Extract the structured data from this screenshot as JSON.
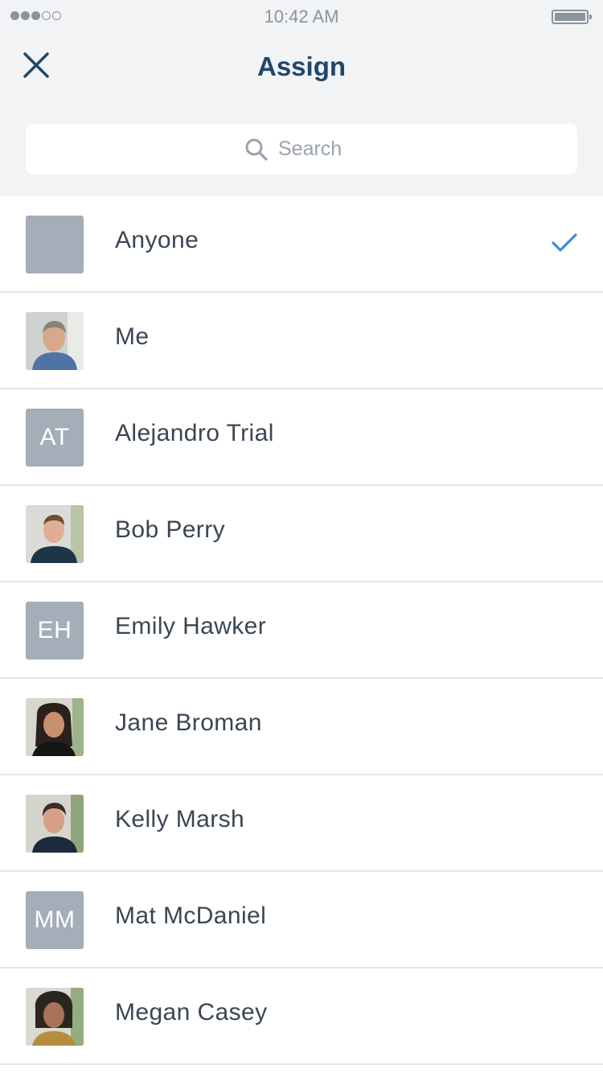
{
  "status_bar": {
    "time": "10:42 AM",
    "signal_bars_filled": 3,
    "signal_bars_total": 5,
    "battery_level": 1.0
  },
  "header": {
    "title": "Assign",
    "close_icon": "close-icon"
  },
  "search": {
    "placeholder": "Search",
    "value": "",
    "icon": "search-icon"
  },
  "colors": {
    "accent": "#20476b",
    "check": "#3a8ed8",
    "avatar_placeholder": "#a3aeb9",
    "background_top": "#f2f3f5"
  },
  "assignees": [
    {
      "name": "Anyone",
      "initials": "",
      "avatar_type": "blank",
      "selected": true
    },
    {
      "name": "Me",
      "initials": "",
      "avatar_type": "photo",
      "selected": false
    },
    {
      "name": "Alejandro Trial",
      "initials": "AT",
      "avatar_type": "initials",
      "selected": false
    },
    {
      "name": "Bob Perry",
      "initials": "",
      "avatar_type": "photo",
      "selected": false
    },
    {
      "name": "Emily Hawker",
      "initials": "EH",
      "avatar_type": "initials",
      "selected": false
    },
    {
      "name": "Jane Broman",
      "initials": "",
      "avatar_type": "photo",
      "selected": false
    },
    {
      "name": "Kelly Marsh",
      "initials": "",
      "avatar_type": "photo",
      "selected": false
    },
    {
      "name": "Mat McDaniel",
      "initials": "MM",
      "avatar_type": "initials",
      "selected": false
    },
    {
      "name": "Megan Casey",
      "initials": "",
      "avatar_type": "photo",
      "selected": false
    }
  ]
}
